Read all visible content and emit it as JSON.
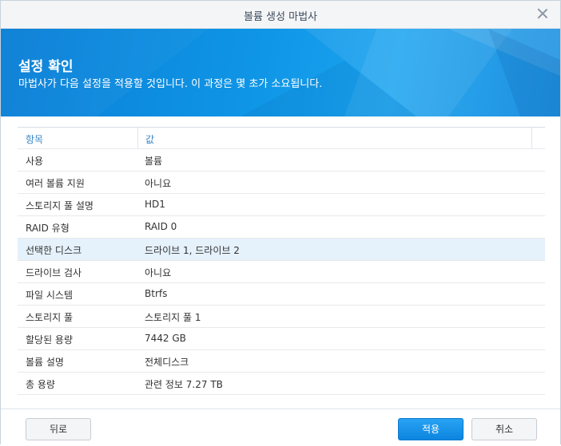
{
  "window": {
    "title": "볼륨 생성 마법사"
  },
  "banner": {
    "title": "설정 확인",
    "subtitle": "마법사가 다음 설정을 적용할 것입니다. 이 과정은 몇 초가 소요됩니다."
  },
  "table": {
    "headers": [
      "항목",
      "값"
    ],
    "rows": [
      [
        "사용",
        "볼륨"
      ],
      [
        "여러 볼륨 지원",
        "아니요"
      ],
      [
        "스토리지 풀 설명",
        "HD1"
      ],
      [
        "RAID 유형",
        "RAID 0"
      ],
      [
        "선택한 디스크",
        "드라이브 1, 드라이브 2"
      ],
      [
        "드라이브 검사",
        "아니요"
      ],
      [
        "파일 시스템",
        "Btrfs"
      ],
      [
        "스토리지 풀",
        "스토리지 풀 1"
      ],
      [
        "할당된 용량",
        "7442 GB"
      ],
      [
        "볼륨 설명",
        "전체디스크"
      ],
      [
        "총 용량",
        "관련 정보 7.27 TB"
      ]
    ],
    "selected_row": 4
  },
  "footer": {
    "back_label": "뒤로",
    "apply_label": "적용",
    "cancel_label": "취소"
  },
  "colors": {
    "accent": "#0c85e0",
    "banner": "#0f95e6",
    "selected_row": "#e5f1fb"
  }
}
